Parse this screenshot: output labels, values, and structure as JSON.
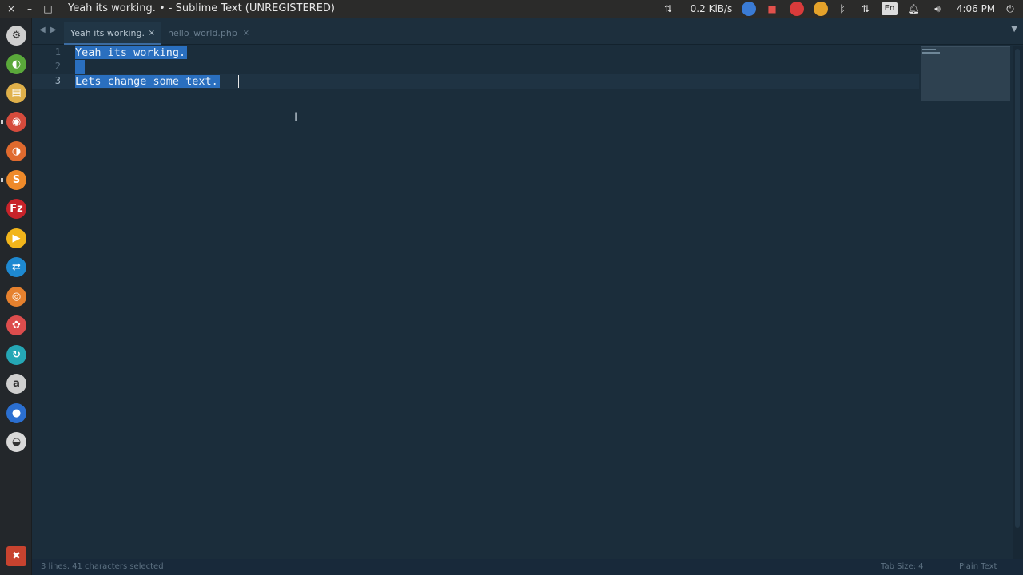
{
  "window": {
    "title": "Yeah its working. • - Sublime Text (UNREGISTERED)",
    "controls": {
      "close": "×",
      "minimize": "–",
      "maximize": "□"
    }
  },
  "tray": {
    "network_speed": "0.2 KiB/s",
    "keyboard_layout": "En",
    "clock": "4:06 PM"
  },
  "launcher": {
    "items": [
      {
        "name": "system-settings",
        "glyph": "⚙",
        "color": "#cfcfcf"
      },
      {
        "name": "web-browser",
        "glyph": "◐",
        "color": "#5aa83a"
      },
      {
        "name": "file-manager",
        "glyph": "▤",
        "color": "#e0b04a"
      },
      {
        "name": "chrome",
        "glyph": "◉",
        "color": "#d64b3c"
      },
      {
        "name": "firefox",
        "glyph": "◑",
        "color": "#e06a2e"
      },
      {
        "name": "sublime-text",
        "glyph": "S",
        "color": "#ef8a2a"
      },
      {
        "name": "filezilla",
        "glyph": "Fz",
        "color": "#c8232a"
      },
      {
        "name": "media-player",
        "glyph": "▶",
        "color": "#f2b51b"
      },
      {
        "name": "teamviewer",
        "glyph": "⇄",
        "color": "#1e89d1"
      },
      {
        "name": "software-center",
        "glyph": "◎",
        "color": "#e6812e"
      },
      {
        "name": "photo-app",
        "glyph": "✿",
        "color": "#dd4d4d"
      },
      {
        "name": "update-app",
        "glyph": "↻",
        "color": "#25a7b5"
      },
      {
        "name": "amazon",
        "glyph": "a",
        "color": "#cfcfcf"
      },
      {
        "name": "drop-app",
        "glyph": "●",
        "color": "#2b6fd1"
      },
      {
        "name": "disk-app",
        "glyph": "◒",
        "color": "#d9d9d9"
      }
    ],
    "trash_glyph": "✖"
  },
  "tabs": [
    {
      "label": "Yeah its working.",
      "close": "×",
      "active": true
    },
    {
      "label": "hello_world.php",
      "close": "×",
      "active": false
    }
  ],
  "editor": {
    "lines": [
      {
        "number": "1",
        "text": "Yeah its working."
      },
      {
        "number": "2",
        "text": ""
      },
      {
        "number": "3",
        "text": "Lets change some text."
      }
    ]
  },
  "status": {
    "selection": "3 lines, 41 characters selected",
    "tab_size": "Tab Size: 4",
    "syntax": "Plain Text"
  },
  "colors": {
    "editor_bg": "#1b2d3b",
    "selection": "#2a6fbf",
    "accent": "#3b6ba0"
  }
}
